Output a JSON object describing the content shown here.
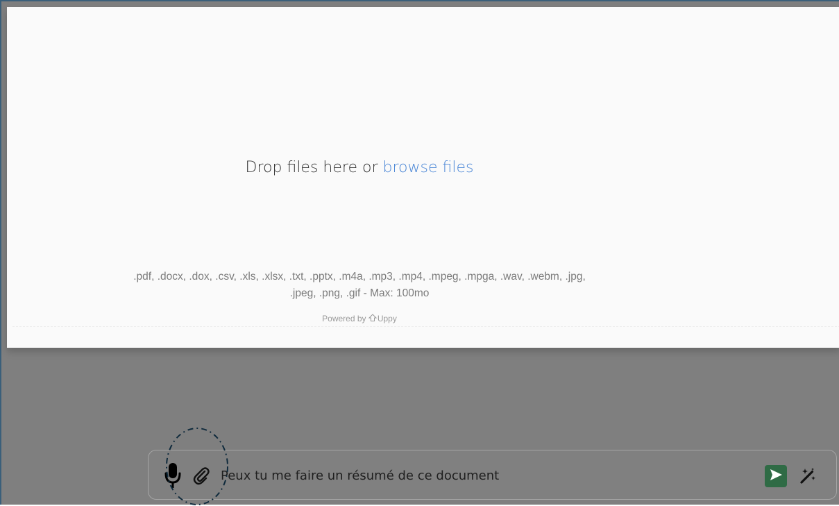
{
  "dropzone": {
    "prompt_prefix": "Drop files here or ",
    "browse_label": "browse files",
    "formats_line1": ".pdf, .docx, .dox, .csv, .xls, .xlsx, .txt, .pptx, .m4a, .mp3, .mp4, .mpeg, .mpga, .wav, .webm, .jpg,",
    "formats_line2": ".jpeg, .png, .gif - Max: 100mo",
    "powered_prefix": "Powered by ",
    "powered_brand": "Uppy"
  },
  "composer": {
    "input_value": "Peux tu me faire un résumé de ce document",
    "icons": {
      "mic": "microphone-icon",
      "attach": "paperclip-icon",
      "send": "send-icon",
      "wand": "magic-wand-icon"
    }
  },
  "colors": {
    "link": "#4a86d6",
    "send_button": "#2f6b45",
    "overlay": "#7f7f7f",
    "dropzone_bg": "#fafafa"
  }
}
